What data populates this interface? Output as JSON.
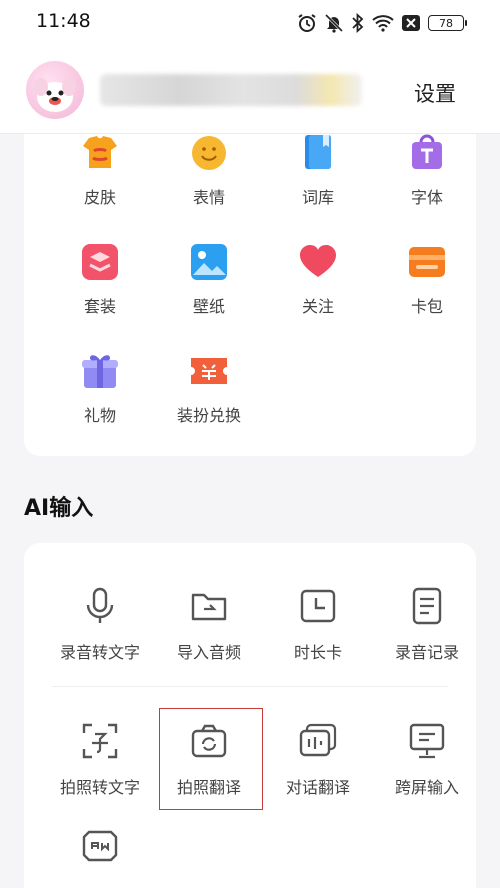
{
  "status_bar": {
    "time": "11:48",
    "battery": "78",
    "icons": [
      "alarm-icon",
      "mute-icon",
      "bluetooth-icon",
      "wifi-icon",
      "close-box-icon",
      "battery-icon"
    ]
  },
  "header": {
    "settings_label": "设置"
  },
  "grid": {
    "items": [
      {
        "label": "皮肤",
        "icon": "skin-shirt-icon"
      },
      {
        "label": "表情",
        "icon": "emoji-icon"
      },
      {
        "label": "词库",
        "icon": "dictionary-icon"
      },
      {
        "label": "字体",
        "icon": "font-bag-icon"
      },
      {
        "label": "套装",
        "icon": "suit-layers-icon"
      },
      {
        "label": "壁纸",
        "icon": "wallpaper-icon"
      },
      {
        "label": "关注",
        "icon": "heart-icon"
      },
      {
        "label": "卡包",
        "icon": "card-wallet-icon"
      },
      {
        "label": "礼物",
        "icon": "gift-icon"
      },
      {
        "label": "装扮兑换",
        "icon": "redeem-ticket-icon"
      }
    ]
  },
  "ai_section": {
    "title": "AI输入",
    "items": [
      {
        "label": "录音转文字",
        "icon": "microphone-icon"
      },
      {
        "label": "导入音频",
        "icon": "folder-icon"
      },
      {
        "label": "时长卡",
        "icon": "clock-card-icon"
      },
      {
        "label": "录音记录",
        "icon": "document-icon"
      },
      {
        "label": "拍照转文字",
        "icon": "scan-text-icon"
      },
      {
        "label": "拍照翻译",
        "icon": "camera-translate-icon"
      },
      {
        "label": "对话翻译",
        "icon": "dialog-translate-icon"
      },
      {
        "label": "跨屏输入",
        "icon": "monitor-input-icon"
      },
      {
        "label": "",
        "icon": "ai-chat-icon"
      }
    ]
  },
  "colors": {
    "accent_red": "#c83a3a",
    "background": "#f5f5f7"
  }
}
